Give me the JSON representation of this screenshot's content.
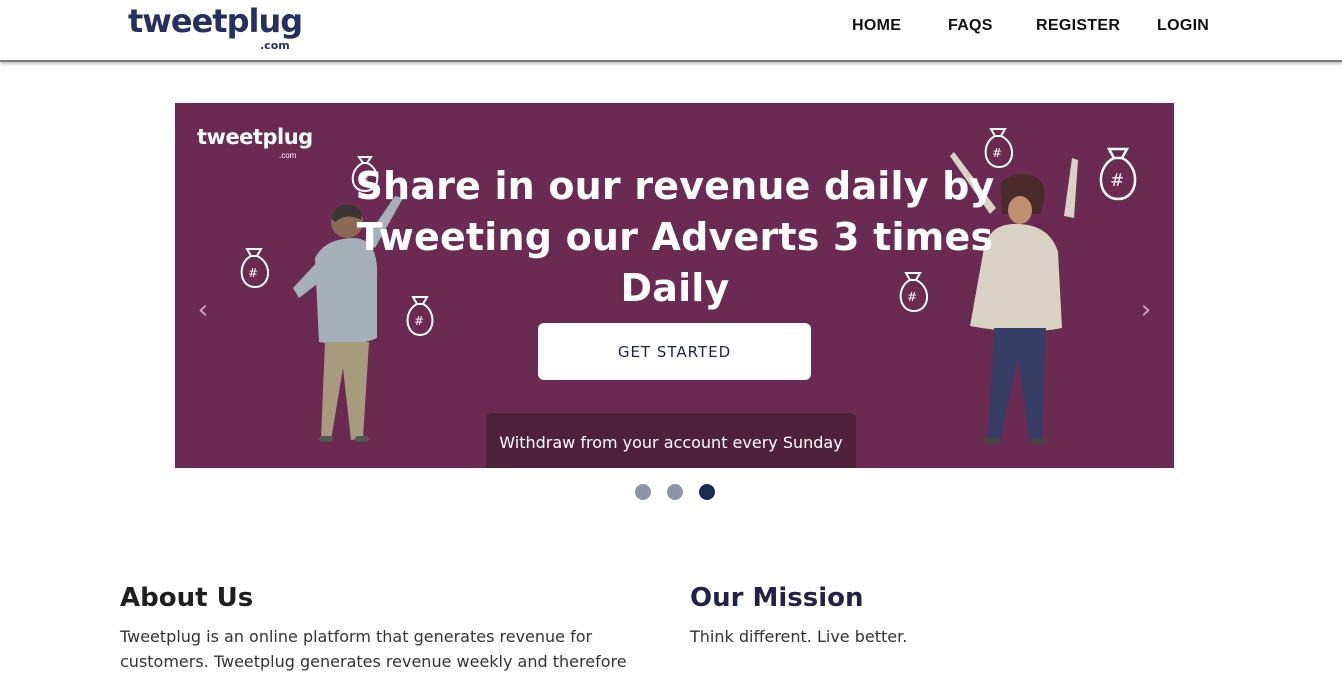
{
  "header": {
    "logo_word": "tweetplug",
    "logo_com": ".com",
    "nav": {
      "home": "HOME",
      "faqs": "FAQS",
      "register": "REGISTER",
      "login": "LOGIN"
    }
  },
  "carousel": {
    "banner_logo_word": "tweetplug",
    "banner_logo_com": ".com",
    "headline": "Share in our revenue daily by Tweeting our Adverts 3 times Daily",
    "cta_label": "GET STARTED",
    "caption": "Withdraw from your account every Sunday",
    "prev_icon": "‹",
    "next_icon": "›",
    "active_slide": 3,
    "slide_count": 3,
    "colors": {
      "background": "#6b2a51",
      "caption_bg": "#4f2138",
      "dot_active": "#1f2a52",
      "dot_inactive": "#8e94a8"
    }
  },
  "about": {
    "title": "About Us",
    "text": "Tweetplug is an online platform that generates revenue for customers. Tweetplug generates revenue weekly and therefore"
  },
  "mission": {
    "title": "Our Mission",
    "text": "Think different. Live better."
  }
}
